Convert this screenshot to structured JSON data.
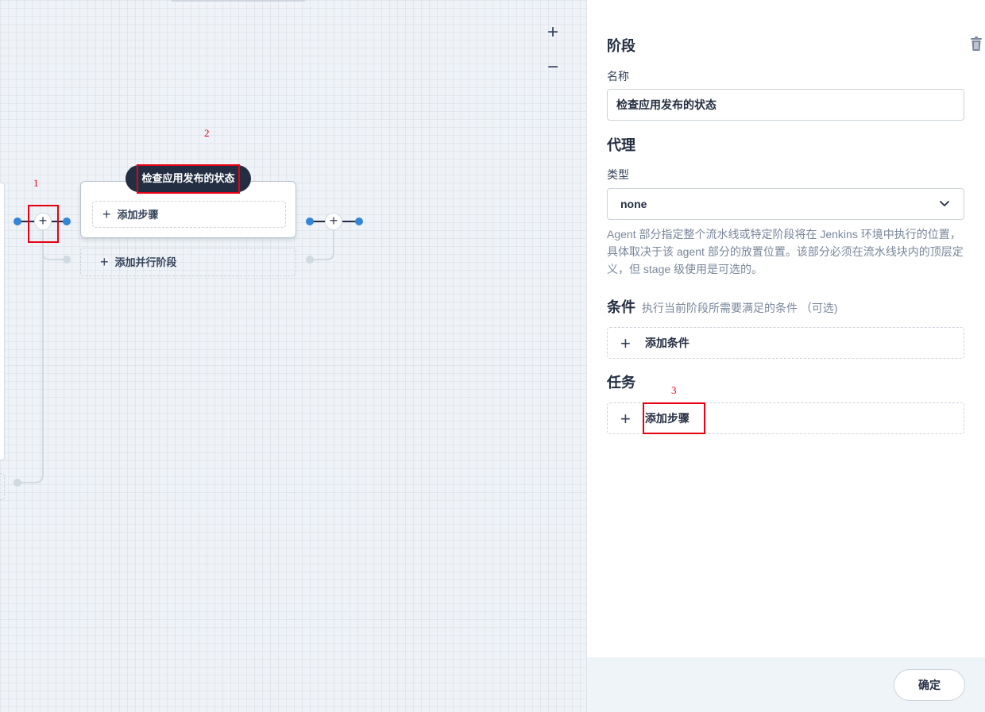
{
  "canvas": {
    "zoom_in": "+",
    "zoom_out": "−",
    "stage": {
      "title": "检查应用发布的状态",
      "add_step_label": "添加步骤",
      "add_parallel_label": "添加并行阶段"
    },
    "plus_glyph": "+",
    "annotations": {
      "label_1": "1",
      "label_2": "2",
      "label_3": "3"
    }
  },
  "panel": {
    "stage_heading": "阶段",
    "name_label": "名称",
    "name_value": "检查应用发布的状态",
    "agent_heading": "代理",
    "type_label": "类型",
    "type_value": "none",
    "agent_description": "Agent 部分指定整个流水线或特定阶段将在 Jenkins 环境中执行的位置， 具体取决于该 agent 部分的放置位置。该部分必须在流水线块内的顶层定义，但 stage 级使用是可选的。",
    "condition_heading": "条件",
    "condition_hint": "执行当前阶段所需要满足的条件 （可选)",
    "add_condition_label": "添加条件",
    "task_heading": "任务",
    "add_step_label": "添加步骤",
    "ok_label": "确定",
    "plus_glyph": "+"
  },
  "colors": {
    "accent_blue": "#3385d6",
    "dark_navy": "#242e42",
    "annotation_red": "#e60012"
  },
  "icons": [
    "plus-icon",
    "minus-icon",
    "trash-icon",
    "chevron-down-icon"
  ]
}
